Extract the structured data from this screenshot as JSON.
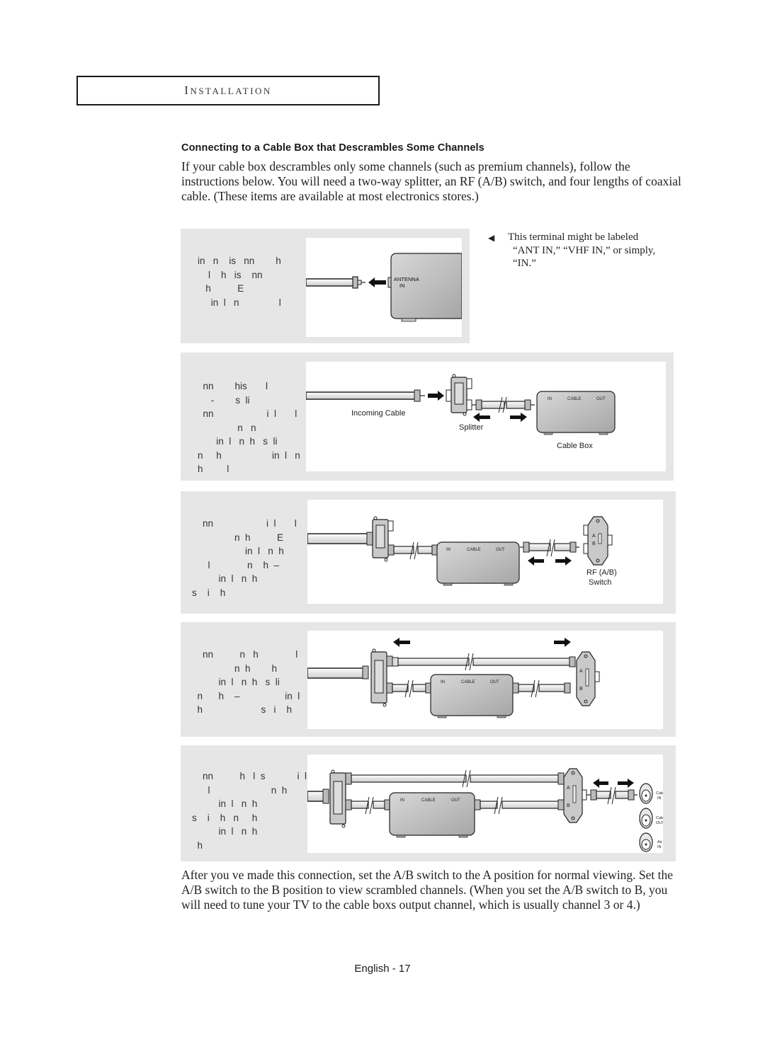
{
  "section_header": {
    "first_letter": "I",
    "rest": "NSTALLATION"
  },
  "heading": "Connecting to a Cable Box that Descrambles Some Channels",
  "intro": "If your cable box descrambles only some channels (such as premium channels), follow the instructions below. You will need a two-way splitter, an RF (A/B) switch, and four lengths of coaxial cable. (These items are available at most electronics stores.)",
  "note": {
    "icon": "left-triangle-icon",
    "lines": [
      "This terminal might be labeled",
      "“ANT IN,” “VHF IN,” or simply,",
      "“IN.”"
    ]
  },
  "steps": [
    {
      "text_fragments": "in   n    is   nn        h\n    l    h   is    nn\n   h          E\n     in  l   n               l",
      "labels": {
        "terminal": "ANTENNA",
        "terminal_sub": "IN"
      }
    },
    {
      "text_fragments": "  nn        his       l\n     -        s  li\n  nn                    i  l       l\n               n   n\n       in  l   n  h   s  li\nn     h                   in  l   n\nh         l",
      "labels": {
        "incoming": "Incoming Cable",
        "splitter": "Splitter",
        "box": "Cable Box",
        "box_in": "IN",
        "box_cable": "CABLE",
        "box_out": "OUT"
      }
    },
    {
      "text_fragments": "    nn                    i  l       l\n                n  h          E\n                    in  l   n  h\n      l              n    h  –\n          in  l   n  h\ns    i    h",
      "labels": {
        "box_in": "IN",
        "box_cable": "CABLE",
        "box_out": "OUT",
        "switch_a": "A",
        "switch_b": "B",
        "switch_label_1": "RF (A/B)",
        "switch_label_2": "Switch"
      }
    },
    {
      "text_fragments": "    nn          n   h              l\n                n  h        h\n          in  l   n  h   s  li\n  n      h    –                 in  l   n\n  h                      s   i    h",
      "labels": {
        "box_in": "IN",
        "box_cable": "CABLE",
        "box_out": "OUT",
        "switch_a": "A",
        "switch_b": "B"
      }
    },
    {
      "text_fragments": "    nn          h   l  s            i  l\n      l                       n  h\n          in  l   n  h\ns    i    h   n     h\n          in  l   n  h\n  h",
      "labels": {
        "box_in": "IN",
        "box_cable": "CABLE",
        "box_out": "OUT",
        "switch_a": "A",
        "switch_b": "B",
        "tv_terminals": [
          {
            "line1": "Cable",
            "line2": "IN"
          },
          {
            "line1": "Cable",
            "line2": "OUT"
          },
          {
            "line1": "Air",
            "line2": "IN"
          }
        ]
      }
    }
  ],
  "outro": "After you ve made this connection, set the A/B switch to the   A   position for normal viewing. Set the A/B switch to the   B   position to view scrambled channels. (When you set the A/B switch to   B,   you will need to tune your TV to the cable boxs output channel, which is usually channel 3 or 4.)",
  "footer": {
    "page_label": "English - 17"
  }
}
